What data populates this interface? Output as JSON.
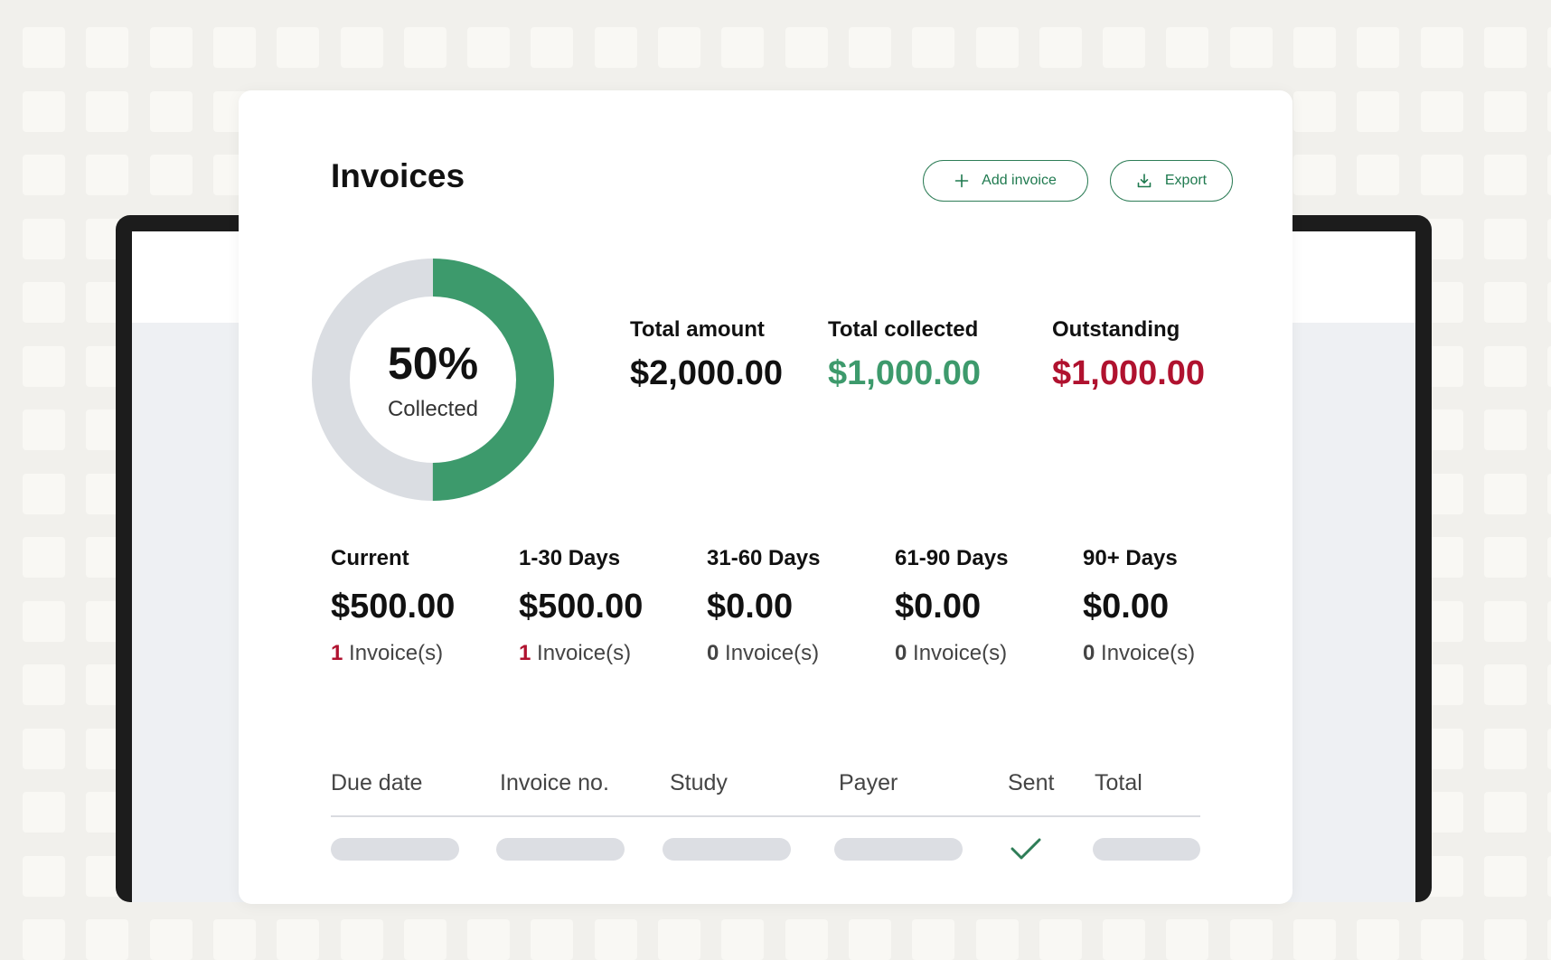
{
  "colors": {
    "accent": "#2e7d57",
    "collected": "#3d9a6c",
    "outstanding": "#b0122f",
    "donut_track": "#dadde2"
  },
  "header": {
    "title": "Invoices",
    "add_invoice_label": "Add invoice",
    "add_invoice_icon": "plus-icon",
    "export_label": "Export",
    "export_icon": "download-icon"
  },
  "donut": {
    "percent_text": "50%",
    "caption": "Collected",
    "fraction_collected": 0.5
  },
  "summary": {
    "total_amount_label": "Total amount",
    "total_amount_value": "$2,000.00",
    "total_collected_label": "Total collected",
    "total_collected_value": "$1,000.00",
    "outstanding_label": "Outstanding",
    "outstanding_value": "$1,000.00"
  },
  "aging": [
    {
      "label": "Current",
      "value": "$500.00",
      "count": "1",
      "suffix": " Invoice(s)",
      "highlight": true
    },
    {
      "label": "1-30 Days",
      "value": "$500.00",
      "count": "1",
      "suffix": " Invoice(s)",
      "highlight": true
    },
    {
      "label": "31-60 Days",
      "value": "$0.00",
      "count": "0",
      "suffix": " Invoice(s)",
      "highlight": false
    },
    {
      "label": "61-90 Days",
      "value": "$0.00",
      "count": "0",
      "suffix": " Invoice(s)",
      "highlight": false
    },
    {
      "label": "90+ Days",
      "value": "$0.00",
      "count": "0",
      "suffix": " Invoice(s)",
      "highlight": false
    }
  ],
  "table": {
    "columns": [
      "Due date",
      "Invoice no.",
      "Study",
      "Payer",
      "Sent",
      "Total"
    ],
    "rows": [
      {
        "sent": true,
        "sent_icon": "checkmark-icon"
      }
    ]
  }
}
